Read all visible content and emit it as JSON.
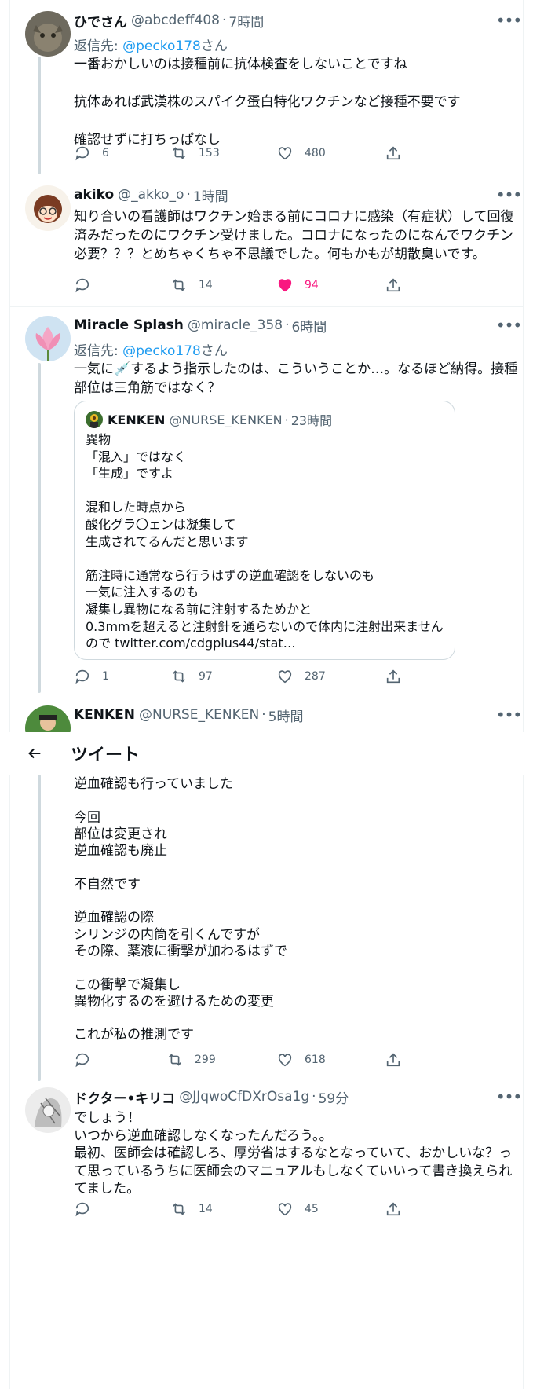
{
  "tweets": [
    {
      "name": "ひでさん",
      "handle": "@abcdeff408",
      "time": "7時間",
      "reply_prefix": "返信先: ",
      "reply_mention": "@pecko178",
      "reply_suffix": "さん",
      "body": "一番おかしいのは接種前に抗体検査をしないことですね\n\n抗体あれば武漢株のスパイク蛋白特化ワクチンなど接種不要です\n\n確認せずに打ちっぱなし",
      "replies": "6",
      "retweets": "153",
      "likes": "480"
    },
    {
      "name": "akiko",
      "handle": "@_akko_o",
      "time": "1時間",
      "body": "知り合いの看護師はワクチン始まる前にコロナに感染（有症状）して回復済みだったのにワクチン受けました。コロナになったのになんでワクチン必要？？？とめちゃくちゃ不思議でした。何もかもが胡散臭いです。",
      "replies": "",
      "retweets": "14",
      "likes": "94"
    },
    {
      "name": "Miracle Splash",
      "handle": "@miracle_358",
      "time": "6時間",
      "reply_prefix": "返信先: ",
      "reply_mention": "@pecko178",
      "reply_suffix": "さん",
      "body_before": "一気に",
      "body_emoji": "💉",
      "body_after": "するよう指示したのは、こういうことか…。なるほど納得。接種部位は三角筋ではなく？",
      "replies": "1",
      "retweets": "97",
      "likes": "287"
    },
    {
      "name": "KENKEN",
      "handle": "@NURSE_KENKEN",
      "time": "5時間",
      "body": "逆血確認も行っていました\n\n今回\n部位は変更され\n逆血確認も廃止\n\n不自然です\n\n逆血確認の際\nシリンジの内筒を引くんですが\nその際、薬液に衝撃が加わるはずで\n\nこの衝撃で凝集し\n異物化するのを避けるための変更\n\nこれが私の推測です",
      "replies": "",
      "retweets": "299",
      "likes": "618"
    },
    {
      "name": "ドクター•キリコ",
      "handle": "@JJqwoCfDXrOsa1g",
      "time": "59分",
      "body": "でしょう！\nいつから逆血確認しなくなったんだろう。。\n最初、医師会は確認しろ、厚労省はするなとなっていて、おかしいな？って思っているうちに医師会のマニュアルもしなくていいって書き換えられてました。",
      "replies": "",
      "retweets": "14",
      "likes": "45"
    }
  ],
  "quote": {
    "name": "KENKEN",
    "handle": "@NURSE_KENKEN",
    "time": "23時間",
    "body": "異物\n「混入」ではなく\n「生成」ですよ\n\n混和した時点から\n酸化グラ〇ェンは凝集して\n生成されてるんだと思います\n\n筋注時に通常なら行うはずの逆血確認をしないのも\n一気に注入するのも\n凝集し異物になる前に注射するためかと\n0.3mmを超えると注射針を通らないので体内に注射出来ませんので twitter.com/cdgplus44/stat…"
  },
  "sticky_header": {
    "title": "ツイート"
  },
  "sep": "·",
  "more": "•••",
  "colors": {
    "like": "#f91880",
    "link": "#1d9bf0",
    "muted": "#536471"
  }
}
